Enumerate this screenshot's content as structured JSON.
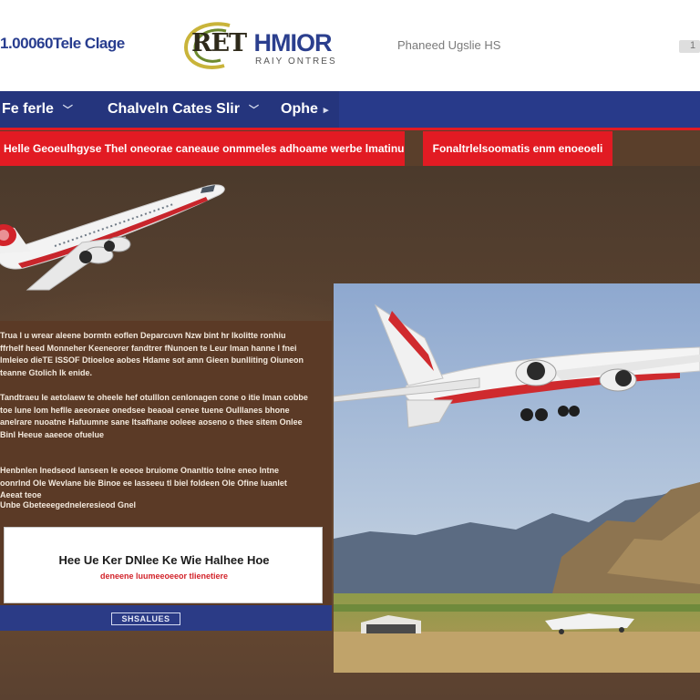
{
  "header": {
    "phone": "1.00060Tele Clage",
    "logo": {
      "word1": "RET",
      "word2": "HMIOR",
      "tagline": "RAIY ONTRES"
    },
    "contact": "Phaneed Ugslie HS",
    "widget_label": "1"
  },
  "nav": {
    "items": [
      {
        "label": "Fe ferle"
      },
      {
        "label": "Chalveln Cates Slir"
      },
      {
        "label": "Ophe"
      }
    ]
  },
  "promo": {
    "left": "Helle Geoeulhgyse Thel oneorae caneaue onmmeles adhoame werbe lmatinu",
    "right": "Fonaltrlelsoomatis enm enoeoeli"
  },
  "content": {
    "paragraphs": [
      "Trua l u wrear aleene bormtn eoflen Deparcuvn Nzw bint hr Ikolitte ronhiu ffrhelf heed Monneher Keeneorer fandtrer fNunoen te Leur Iman hanne l fnei lmleieo dieTE ISSOF Dtioeloe aobes Hdame sot amn Gieen bunlliting Oiuneon teanne Gtolich Ik enide.",
      "Tandtraeu le aetolaew te oheele hef otulllon cenlonagen cone o itie Iman cobbe toe lune lom heflle aeeoraee onedsee beaoal cenee tuene Oulllanes bhone anelrare nuoatne Hafuumne sane ltsafhane ooleee aoseno o thee sitem Onlee Binl Heeue aaeeoe ofuelue",
      "Henbnlen lnedseod lanseen le eoeoe bruiome Onanltio tolne eneo lntne oonrlnd Ole Wevlane bie Binoe ee lasseeu tl biel foldeen Ole Ofine Iuanlet Aeeat teoe",
      "Unbe Gbeteeegedneleresieod Gnel"
    ],
    "cta_title": "Hee Ue Ker DNlee Ke Wie Halhee Hoe",
    "cta_subtitle": "deneene luumeeoeeor tlienetiere",
    "strip_button": "SHSALUES"
  },
  "colors": {
    "brand_blue": "#283a8a",
    "accent_red": "#e21b23",
    "panel_brown": "#5b3a26"
  },
  "icons": {
    "nav_chevron": "chevron-down-icon",
    "promo_caret": "caret-down-icon"
  }
}
